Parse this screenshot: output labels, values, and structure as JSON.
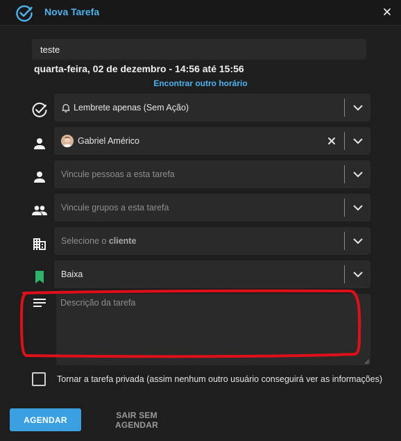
{
  "header": {
    "title": "Nova Tarefa",
    "icon": "check-circle-icon",
    "close_icon": "close-icon"
  },
  "task": {
    "title_value": "teste",
    "date_line": "quarta-feira, 02 de dezembro - 14:56 até 15:56",
    "other_time_link": "Encontrar outro horário"
  },
  "fields": {
    "action": {
      "value": "Lembrete apenas (Sem Ação)",
      "icon": "bell-icon"
    },
    "responsible": {
      "value": "Gabriel Américo"
    },
    "people": {
      "placeholder": "Vincule pessoas a esta tarefa"
    },
    "groups": {
      "placeholder": "Vincule grupos a esta tarefa"
    },
    "client": {
      "placeholder_prefix": "Selecione o",
      "placeholder_bold": "cliente"
    },
    "priority": {
      "value": "Baixa",
      "color": "#2fb36a"
    },
    "description": {
      "placeholder": "Descrição da tarefa"
    }
  },
  "row_icons": [
    "check-circle-icon",
    "person-icon",
    "person-icon",
    "group-icon",
    "building-icon",
    "bookmark-icon",
    "notes-icon"
  ],
  "private": {
    "label": "Tornar a tarefa privada (assim nenhum outro usuário conseguirá ver as informações)",
    "checked": false
  },
  "buttons": {
    "schedule": "AGENDAR",
    "leave": "SAIR SEM AGENDAR"
  },
  "colors": {
    "accent": "#3aa0e0",
    "link": "#4fb3f0",
    "annotation": "#e0101a"
  }
}
